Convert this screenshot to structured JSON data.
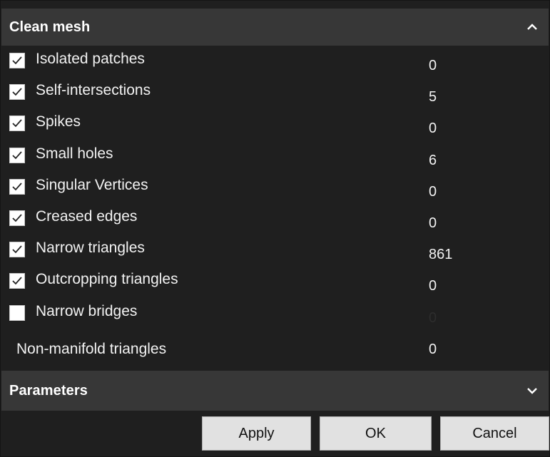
{
  "clean_mesh": {
    "title": "Clean mesh",
    "toggle_icon": "chevron-up-icon",
    "items": [
      {
        "label": "Isolated patches",
        "value": "0",
        "checked": true
      },
      {
        "label": "Self-intersections",
        "value": "5",
        "checked": true
      },
      {
        "label": "Spikes",
        "value": "0",
        "checked": true
      },
      {
        "label": "Small holes",
        "value": "6",
        "checked": true
      },
      {
        "label": "Singular Vertices",
        "value": "0",
        "checked": true
      },
      {
        "label": "Creased edges",
        "value": "0",
        "checked": true
      },
      {
        "label": "Narrow triangles",
        "value": "861",
        "checked": true
      },
      {
        "label": "Outcropping triangles",
        "value": "0",
        "checked": true
      },
      {
        "label": "Narrow bridges",
        "value": "0",
        "checked": false
      },
      {
        "label": "Non-manifold triangles",
        "value": "0"
      }
    ]
  },
  "parameters": {
    "title": "Parameters",
    "toggle_icon": "chevron-down-icon"
  },
  "buttons": {
    "apply": "Apply",
    "ok": "OK",
    "cancel": "Cancel"
  },
  "colors": {
    "header_bg": "#373737",
    "panel_bg": "#1f1f1f",
    "button_bg": "#e1e1e1"
  }
}
